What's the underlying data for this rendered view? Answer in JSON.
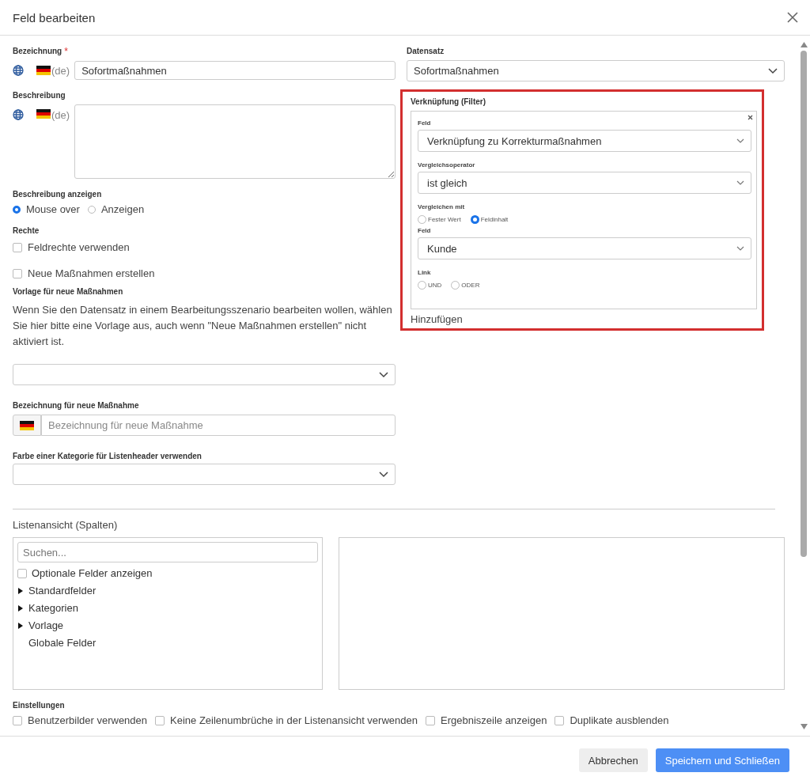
{
  "dialog": {
    "title": "Feld bearbeiten"
  },
  "bezeichnung": {
    "label": "Bezeichnung",
    "required_mark": "*",
    "lang": "(de)",
    "value": "Sofortmaßnahmen"
  },
  "beschreibung": {
    "label": "Beschreibung",
    "lang": "(de)"
  },
  "beschreibung_anzeigen": {
    "label": "Beschreibung anzeigen",
    "options": [
      {
        "label": "Mouse over",
        "selected": true
      },
      {
        "label": "Anzeigen",
        "selected": false
      }
    ]
  },
  "rechte": {
    "label": "Rechte",
    "checkboxes": [
      {
        "label": "Feldrechte verwenden",
        "checked": false
      },
      {
        "label": "Neue Maßnahmen erstellen",
        "checked": false
      }
    ]
  },
  "vorlage": {
    "label": "Vorlage für neue Maßnahmen",
    "hint": "Wenn Sie den Datensatz in einem Bearbeitungsszenario bearbeiten wollen, wählen Sie hier bitte eine Vorlage aus, auch wenn \"Neue Maßnahmen erstellen\" nicht aktiviert ist."
  },
  "bezeichnung_neu": {
    "label": "Bezeichnung für neue Maßnahme",
    "placeholder": "Bezeichnung für neue Maßnahme"
  },
  "farbe": {
    "label": "Farbe einer Kategorie für Listenheader verwenden"
  },
  "datensatz": {
    "label": "Datensatz",
    "value": "Sofortmaßnahmen"
  },
  "filter": {
    "title": "Verknüpfung (Filter)",
    "field_label": "Feld",
    "field_value": "Verknüpfung zu Korrekturmaßnahmen",
    "operator_label": "Vergleichsoperator",
    "operator_value": "ist gleich",
    "compare_label": "Vergleichen mit",
    "compare_options": [
      {
        "label": "Fester Wert",
        "selected": false
      },
      {
        "label": "Feldinhalt",
        "selected": true
      }
    ],
    "field2_label": "Feld",
    "field2_value": "Kunde",
    "link_label": "Link",
    "link_options": [
      {
        "label": "UND",
        "selected": false
      },
      {
        "label": "ODER",
        "selected": false
      }
    ],
    "add": "Hinzufügen"
  },
  "list_view": {
    "title": "Listenansicht (Spalten)",
    "search_placeholder": "Suchen...",
    "optional": {
      "label": "Optionale Felder anzeigen",
      "checked": false
    },
    "tree": [
      {
        "label": "Standardfelder",
        "kind": "group",
        "expanded": false
      },
      {
        "label": "Kategorien",
        "kind": "group",
        "expanded": false
      },
      {
        "label": "Vorlage",
        "kind": "group",
        "expanded": false
      },
      {
        "label": "Globale Felder",
        "kind": "leaf"
      }
    ]
  },
  "settings": {
    "label": "Einstellungen",
    "checkboxes": [
      {
        "label": "Benutzerbilder verwenden",
        "checked": false
      },
      {
        "label": "Keine Zeilenumbrüche in der Listenansicht verwenden",
        "checked": false
      },
      {
        "label": "Ergebniszeile anzeigen",
        "checked": false
      },
      {
        "label": "Duplikate ausblenden",
        "checked": false
      }
    ]
  },
  "buttons": [
    {
      "label": "Abbrechen",
      "kind": "secondary"
    },
    {
      "label": "Speichern und Schließen",
      "kind": "primary"
    }
  ]
}
